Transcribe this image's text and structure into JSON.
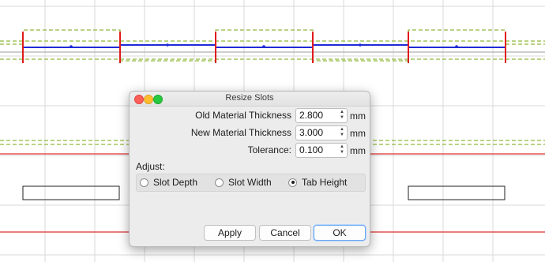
{
  "dialog": {
    "title": "Resize Slots",
    "fields": [
      {
        "label": "Old Material Thickness",
        "value": "2.800",
        "unit": "mm"
      },
      {
        "label": "New Material Thickness",
        "value": "3.000",
        "unit": "mm"
      },
      {
        "label": "Tolerance:",
        "value": "0.100",
        "unit": "mm"
      }
    ],
    "adjust_label": "Adjust:",
    "adjust_options": [
      {
        "label": "Slot Depth",
        "selected": false
      },
      {
        "label": "Slot Width",
        "selected": false
      },
      {
        "label": "Tab Height",
        "selected": true
      }
    ],
    "buttons": {
      "apply": "Apply",
      "cancel": "Cancel",
      "ok": "OK"
    }
  },
  "colors": {
    "grid": "#d9d9d9",
    "outline_blue": "#1f2bd6",
    "guide_green": "#8fb93a",
    "red_line": "#e0302e",
    "handle_red": "#e01b1b"
  }
}
